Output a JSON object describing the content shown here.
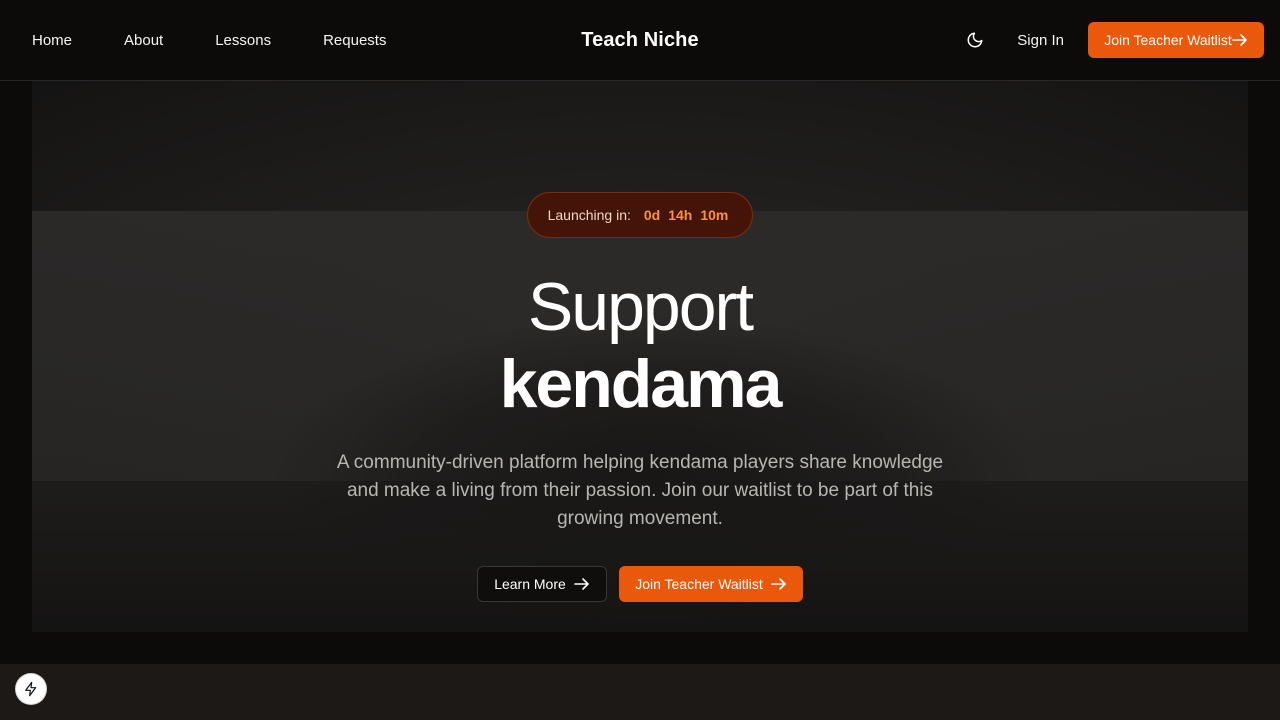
{
  "nav": {
    "links": [
      "Home",
      "About",
      "Lessons",
      "Requests"
    ],
    "brand": "Teach Niche",
    "signin": "Sign In",
    "cta": "Join Teacher Waitlist"
  },
  "hero": {
    "launch_label": "Launching in:",
    "countdown": {
      "days": "0d",
      "hours": "14h",
      "minutes": "10m"
    },
    "headline_1": "Support",
    "headline_2": "kendama",
    "subtext": "A community-driven platform helping kendama players share knowledge and make a living from their passion. Join our waitlist to be part of this growing movement.",
    "learn_more": "Learn More",
    "cta": "Join Teacher Waitlist"
  },
  "colors": {
    "accent": "#ea580c",
    "countdown": "#fb923c",
    "pill_bg": "#431407",
    "page_bg": "#0c0b0a"
  },
  "icons": {
    "theme": "moon-icon",
    "arrow": "arrow-right-icon",
    "badge": "lightning-bolt-icon"
  }
}
